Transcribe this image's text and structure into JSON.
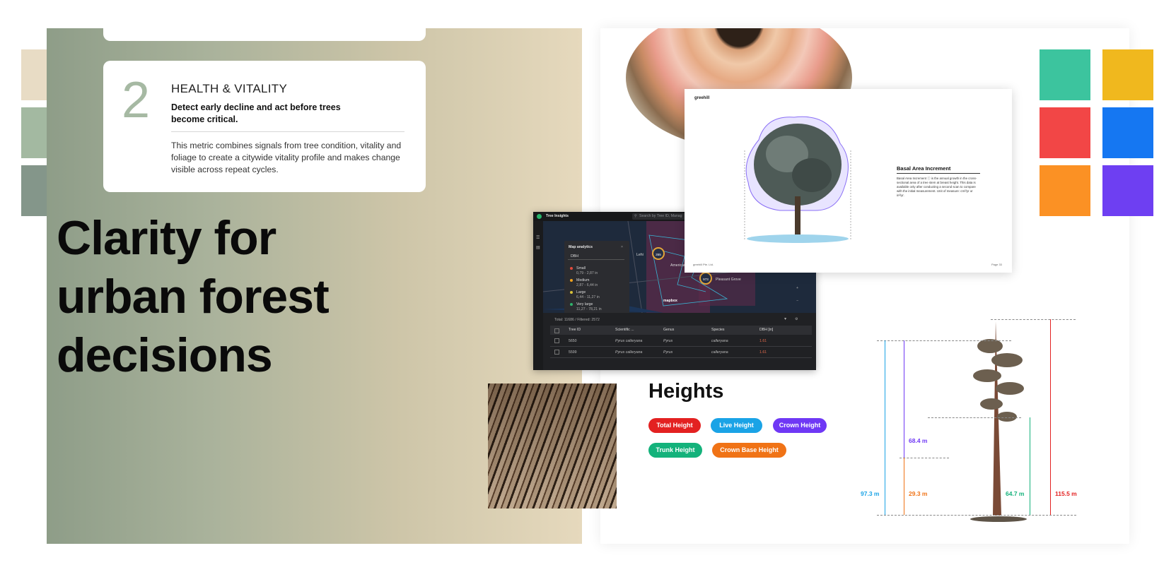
{
  "colors": {
    "left_swatches": [
      "#e8dcc5",
      "#a3b9a1",
      "#84968a"
    ],
    "right_swatches": [
      "#3cc49e",
      "#f0b81e",
      "#f24646",
      "#1577f2",
      "#fb9124",
      "#6e3ff2"
    ],
    "total_height": "#e32121",
    "live_height": "#1aa3e6",
    "crown_height": "#6f38f5",
    "trunk_height": "#14b27b",
    "crown_base_height": "#f07316"
  },
  "card": {
    "number": "2",
    "title": "HEALTH & VITALITY",
    "subtitle": "Detect early decline and act before trees become critical.",
    "body": "This metric combines signals from tree condition, vitality and foliage to create a citywide vitality profile and makes change visible across repeat cycles."
  },
  "headline": {
    "line1": "Clarity for",
    "line2": "urban forest",
    "line3": "decisions"
  },
  "report": {
    "logo": "greehill",
    "heading": "Basal Area Increment",
    "text": "Basal Area Increment ⓘ is the annual growth in the cross-sectional area of a tree stem at breast height. This data is available only after conducting a second scan to compare with the initial measurement. Unit of measure: cm²/yr or in²/yr.",
    "footer": "greehill Pte. Ltd.",
    "page": "Page 33"
  },
  "app": {
    "title": "Tree Insights",
    "search_placeholder": "Search by Tree ID, Manag",
    "legend": {
      "title": "Map analytics",
      "close": "×",
      "select_value": "DBH",
      "items": [
        {
          "name": "Small",
          "range": "0,79 - 2,87 in",
          "color": "#e34b3d"
        },
        {
          "name": "Medium",
          "range": "2,87 - 6,44 in",
          "color": "#f0a21d"
        },
        {
          "name": "Large",
          "range": "6,44 - 11,27 in",
          "color": "#d8c23a"
        },
        {
          "name": "Very large",
          "range": "11,27 - 78,21 in",
          "color": "#2fb36b"
        }
      ]
    },
    "map": {
      "place_lehi": "Lehi",
      "place_american_fork": "American",
      "place_pleasant_grove": "Pleasant Grove",
      "cluster_1": "355",
      "cluster_2": "973",
      "brand": "mapbox"
    },
    "table": {
      "total": "Total: 11686 / Filtered: 2572",
      "columns": [
        "Tree ID",
        "Scientific ...",
        "Genus",
        "Species",
        "DBH [in]"
      ],
      "rows": [
        {
          "id": "5650",
          "scientific": "Pyrus calleryana",
          "genus": "Pyrus",
          "species": "calleryana",
          "dbh": "1.61"
        },
        {
          "id": "5599",
          "scientific": "Pyrus calleryana",
          "genus": "Pyrus",
          "species": "calleryana",
          "dbh": "1.61"
        }
      ]
    }
  },
  "heights": {
    "title": "Heights",
    "pills": {
      "total": "Total Height",
      "live": "Live Height",
      "crown": "Crown Height",
      "trunk": "Trunk Height",
      "crown_base": "Crown Base Height"
    },
    "measurements": {
      "crown": "68.4 m",
      "live": "97.3 m",
      "crown_base": "29.3 m",
      "trunk": "64.7 m",
      "total": "115.5 m"
    }
  }
}
